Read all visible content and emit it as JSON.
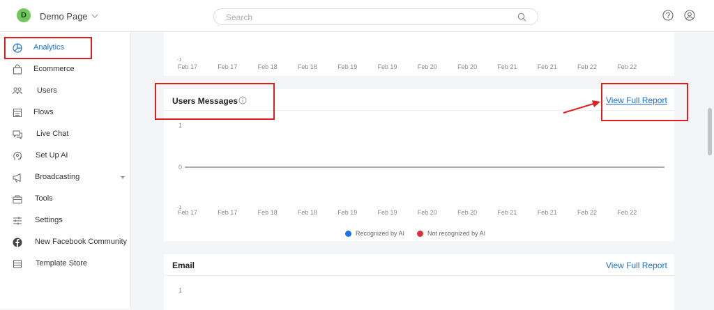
{
  "header": {
    "avatar_letter": "D",
    "page_name": "Demo Page",
    "search_placeholder": "Search"
  },
  "sidebar": {
    "items": [
      {
        "label": "Analytics",
        "icon": "pie-chart-icon",
        "active": true
      },
      {
        "label": "Ecommerce",
        "icon": "shopping-bag-icon"
      },
      {
        "label": "Users",
        "icon": "users-icon"
      },
      {
        "label": "Flows",
        "icon": "flows-icon"
      },
      {
        "label": "Live Chat",
        "icon": "chat-icon"
      },
      {
        "label": "Set Up AI",
        "icon": "ai-head-icon"
      },
      {
        "label": "Broadcasting",
        "icon": "megaphone-icon",
        "has_submenu": true
      },
      {
        "label": "Tools",
        "icon": "toolbox-icon"
      },
      {
        "label": "Settings",
        "icon": "sliders-icon"
      },
      {
        "label": "New Facebook Community",
        "icon": "facebook-icon"
      },
      {
        "label": "Template Store",
        "icon": "store-icon"
      }
    ]
  },
  "top_chart": {
    "x_labels": [
      "Feb 17",
      "Feb 17",
      "Feb 18",
      "Feb 18",
      "Feb 19",
      "Feb 19",
      "Feb 20",
      "Feb 20",
      "Feb 21",
      "Feb 21",
      "Feb 22",
      "Feb 22"
    ],
    "y_min_label": "-1"
  },
  "users_messages": {
    "title": "Users Messages",
    "view_report": "View Full Report",
    "chart_data": {
      "type": "line",
      "categories": [
        "Feb 17",
        "Feb 17",
        "Feb 18",
        "Feb 18",
        "Feb 19",
        "Feb 19",
        "Feb 20",
        "Feb 20",
        "Feb 21",
        "Feb 21",
        "Feb 22",
        "Feb 22"
      ],
      "y_ticks": [
        "1",
        "0",
        "-1"
      ],
      "ylim": [
        -1,
        1
      ],
      "series": [
        {
          "name": "Recognized by AI",
          "color": "#1a73e8",
          "values": [
            0,
            0,
            0,
            0,
            0,
            0,
            0,
            0,
            0,
            0,
            0,
            0
          ]
        },
        {
          "name": "Not recognized by AI",
          "color": "#d93040",
          "values": [
            0,
            0,
            0,
            0,
            0,
            0,
            0,
            0,
            0,
            0,
            0,
            0
          ]
        }
      ]
    }
  },
  "email": {
    "title": "Email",
    "view_report": "View Full Report",
    "y_top_label": "1"
  },
  "colors": {
    "accent": "#1a6fd6",
    "annotation": "#e02020",
    "avatar": "#6ec95a"
  }
}
